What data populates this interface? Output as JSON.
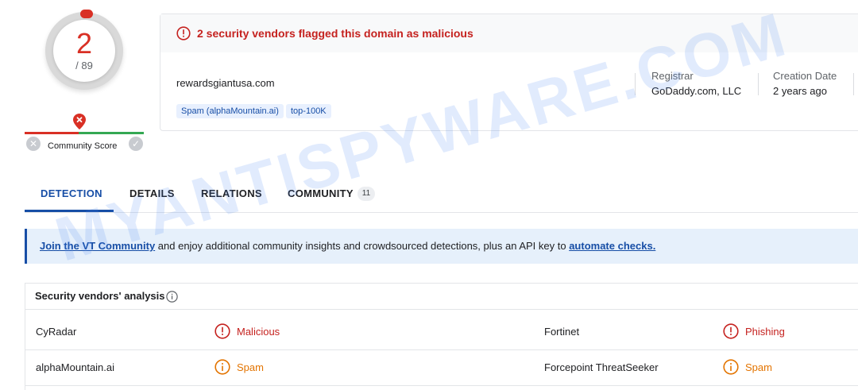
{
  "score": {
    "detections": "2",
    "total": "/ 89"
  },
  "community": {
    "label": "Community Score"
  },
  "alert": {
    "text": "2 security vendors flagged this domain as malicious"
  },
  "domain": {
    "name": "rewardsgiantusa.com",
    "tags": [
      "Spam (alphaMountain.ai)",
      "top-100K"
    ]
  },
  "meta": {
    "registrar_label": "Registrar",
    "registrar_value": "GoDaddy.com, LLC",
    "creation_label": "Creation Date",
    "creation_value": "2 years ago"
  },
  "tabs": [
    {
      "label": "DETECTION",
      "active": true
    },
    {
      "label": "DETAILS"
    },
    {
      "label": "RELATIONS"
    },
    {
      "label": "COMMUNITY",
      "badge": "11"
    }
  ],
  "banner": {
    "link1": "Join the VT Community",
    "middle": " and enjoy additional community insights and crowdsourced detections, plus an API key to ",
    "link2": "automate checks."
  },
  "vendors": {
    "title": "Security vendors' analysis",
    "rows": [
      {
        "left_vendor": "CyRadar",
        "left_result": "Malicious",
        "right_vendor": "Fortinet",
        "right_result": "Phishing"
      },
      {
        "left_vendor": "alphaMountain.ai",
        "left_result": "Spam",
        "right_vendor": "Forcepoint ThreatSeeker",
        "right_result": "Spam"
      }
    ]
  },
  "watermark": "MYANTISPYWARE.COM",
  "colors": {
    "malicious": "#c5221f",
    "spam": "#e37400",
    "accent": "#174ea6"
  },
  "icons": [
    "map-pin-icon",
    "close-icon",
    "check-icon",
    "alert-circle-icon",
    "info-icon"
  ]
}
